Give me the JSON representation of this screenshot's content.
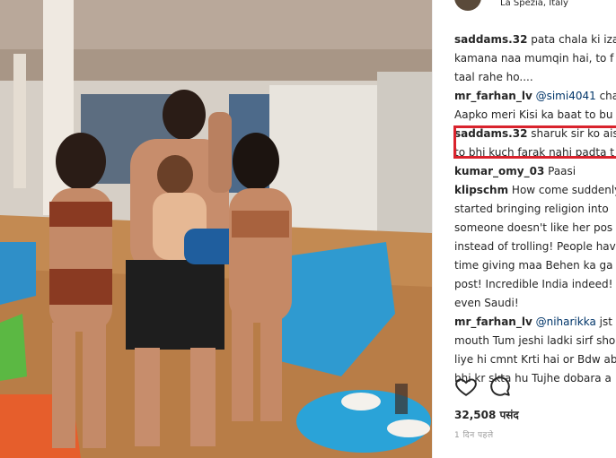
{
  "post": {
    "location": "La Spezia, Italy",
    "likes": "32,508 पसंद",
    "time_ago": "1 दिन पहले"
  },
  "comments": [
    {
      "lines": [
        [
          {
            "t": "user",
            "v": "saddams.32"
          },
          {
            "t": "text",
            "v": " pata chala ki izat"
          }
        ],
        [
          {
            "t": "text",
            "v": "kamana naa mumqin hai, to f"
          }
        ],
        [
          {
            "t": "text",
            "v": "taal rahe ho...."
          }
        ]
      ]
    },
    {
      "lines": [
        [
          {
            "t": "user",
            "v": "mr_farhan_lv"
          },
          {
            "t": "mention",
            "v": " @simi4041"
          },
          {
            "t": "text",
            "v": " chal"
          }
        ],
        [
          {
            "t": "text",
            "v": "Aapko meri Kisi ka baat to bu"
          }
        ]
      ]
    },
    {
      "lines": [
        [
          {
            "t": "user",
            "v": "saddams.32"
          },
          {
            "t": "text",
            "v": " sharuk sir ko aisi"
          }
        ],
        [
          {
            "t": "text",
            "v": "to bhi kuch farak nahi padta t"
          }
        ]
      ]
    },
    {
      "lines": [
        [
          {
            "t": "user",
            "v": "kumar_omy_03"
          },
          {
            "t": "text",
            "v": " Paasi"
          }
        ]
      ]
    },
    {
      "lines": [
        [
          {
            "t": "user",
            "v": "klipschm"
          },
          {
            "t": "text",
            "v": " How come suddenly"
          }
        ],
        [
          {
            "t": "text",
            "v": "started bringing religion into"
          }
        ],
        [
          {
            "t": "text",
            "v": "someone doesn't like her pos"
          }
        ],
        [
          {
            "t": "text",
            "v": "instead of trolling! People hav"
          }
        ],
        [
          {
            "t": "text",
            "v": "time giving maa Behen ka ga"
          }
        ],
        [
          {
            "t": "text",
            "v": "post! Incredible India indeed!"
          }
        ],
        [
          {
            "t": "text",
            "v": "even Saudi!"
          }
        ]
      ]
    },
    {
      "lines": [
        [
          {
            "t": "user",
            "v": "mr_farhan_lv"
          },
          {
            "t": "mention",
            "v": " @niharikka"
          },
          {
            "t": "text",
            "v": " jst S"
          }
        ],
        [
          {
            "t": "text",
            "v": "mouth Tum jeshi ladki sirf sho"
          }
        ],
        [
          {
            "t": "text",
            "v": "liye hi cmnt Krti hai or Bdw ab"
          }
        ],
        [
          {
            "t": "text",
            "v": "bhi kr skta hu Tujhe dobara a"
          }
        ]
      ]
    }
  ],
  "icons": {
    "like": "heart-icon",
    "comment": "comment-icon"
  },
  "colors": {
    "highlight": "#d9232d",
    "mention": "#003569",
    "text": "#262626"
  }
}
